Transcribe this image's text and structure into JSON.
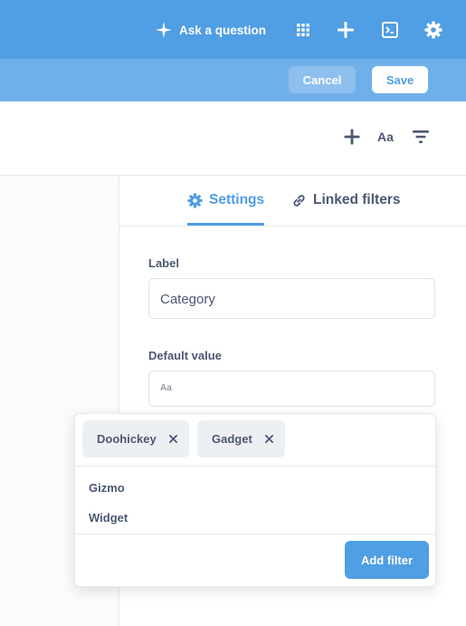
{
  "topbar": {
    "ask_label": "Ask a question",
    "icons": [
      "sparkle-icon",
      "grid-icon",
      "plus-icon",
      "terminal-icon",
      "gear-icon"
    ],
    "background": "#509ee3"
  },
  "editbar": {
    "cancel_label": "Cancel",
    "save_label": "Save"
  },
  "toolbar": {
    "text_tool_label": "Aa",
    "icons": [
      "plus-icon",
      "text-icon",
      "filter-icon"
    ]
  },
  "tabs": {
    "settings_label": "Settings",
    "linked_label": "Linked filters",
    "active": "Settings"
  },
  "form": {
    "label_title": "Label",
    "label_value": "Category",
    "default_title": "Default value",
    "default_placeholder": "Aa"
  },
  "popover": {
    "chips": [
      {
        "label": "Doohickey"
      },
      {
        "label": "Gadget"
      }
    ],
    "options": [
      {
        "label": "Gizmo"
      },
      {
        "label": "Widget"
      }
    ],
    "add_label": "Add filter"
  },
  "colors": {
    "accent": "#509ee3",
    "text": "#4c5773"
  }
}
